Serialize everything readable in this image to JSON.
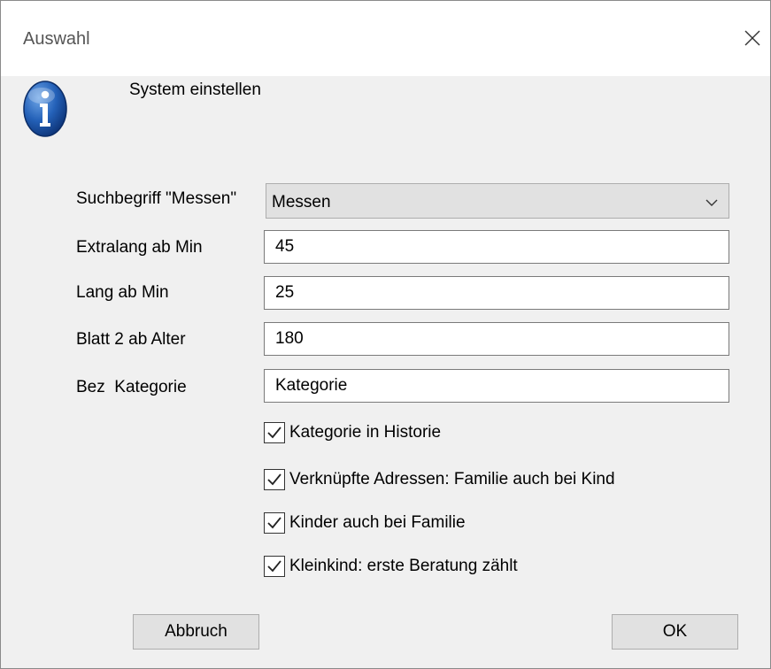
{
  "window": {
    "title": "Auswahl",
    "close_icon": "close-icon"
  },
  "header": {
    "icon": "info-icon",
    "label": "System einstellen"
  },
  "form": {
    "search_term": {
      "label": "Suchbegriff \"Messen\"",
      "value": "Messen"
    },
    "extra_long": {
      "label": "Extralang ab Min",
      "value": "45"
    },
    "long": {
      "label": "Lang ab Min",
      "value": "25"
    },
    "sheet2": {
      "label": "Blatt 2 ab Alter",
      "value": "180"
    },
    "category_name": {
      "label": "Bez  Kategorie",
      "value": "Kategorie"
    }
  },
  "options": [
    {
      "label": "Kategorie in Historie",
      "checked": true
    },
    {
      "label": "Verknüpfte Adressen: Familie auch bei Kind",
      "checked": true
    },
    {
      "label": "Kinder auch bei Familie",
      "checked": true
    },
    {
      "label": "Kleinkind: erste Beratung zählt",
      "checked": true
    }
  ],
  "buttons": {
    "cancel": "Abbruch",
    "ok": "OK"
  },
  "colors": {
    "dialog_bg": "#f0f0f0",
    "titlebar_bg": "#ffffff",
    "info_icon_blue": "#1a4f9c"
  }
}
